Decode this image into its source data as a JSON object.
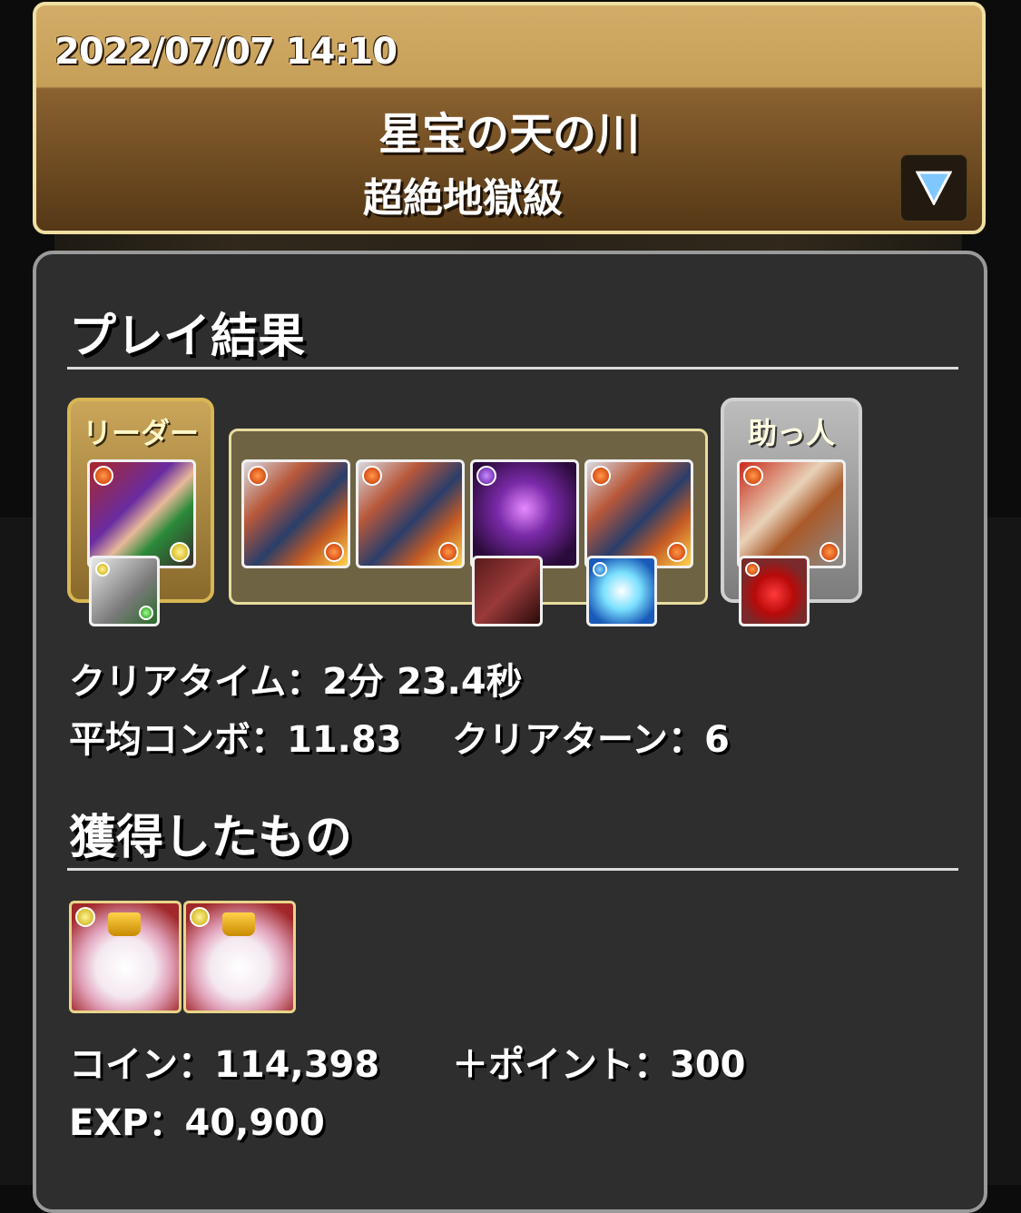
{
  "header": {
    "datetime": "2022/07/07 14:10",
    "dungeon_name": "星宝の天の川",
    "difficulty": "超絶地獄級"
  },
  "results": {
    "section_title": "プレイ結果",
    "leader_label": "リーダー",
    "helper_label": "助っ人",
    "clear_time_label": "クリアタイム：",
    "clear_time_value": "2分 23.4秒",
    "avg_combo_label": "平均コンボ：",
    "avg_combo_value": "11.83",
    "clear_turn_label": "クリアターン：",
    "clear_turn_value": "6"
  },
  "rewards": {
    "section_title": "獲得したもの",
    "coin_label": "コイン：",
    "coin_value": "114,398",
    "points_label": "＋ポイント：",
    "points_value": "300",
    "exp_label": "EXP：",
    "exp_value": "40,900",
    "drops": [
      {
        "icon": "tamazo-king-icon",
        "attribute": "light"
      },
      {
        "icon": "tamazo-king-icon",
        "attribute": "light"
      }
    ]
  },
  "team": {
    "leader": {
      "icon": "pirate-monster-icon",
      "main_attr": "fire",
      "sub_attr": "light",
      "assist": "card-assist-icon"
    },
    "subs": [
      {
        "icon": "fire-dragon-icon",
        "main_attr": "fire",
        "sub_attr": "fire"
      },
      {
        "icon": "fire-dragon-icon",
        "main_attr": "fire",
        "sub_attr": "fire"
      },
      {
        "icon": "void-monster-icon",
        "main_attr": "dark",
        "sub_attr": "",
        "assist": "book-assist-icon"
      },
      {
        "icon": "fire-dragon-icon",
        "main_attr": "fire",
        "sub_attr": "fire",
        "assist": "pet-assist-icon"
      }
    ],
    "helper": {
      "icon": "helper-monster-icon",
      "main_attr": "fire",
      "sub_attr": "fire",
      "assist": "apple-assist-icon"
    }
  },
  "colors": {
    "header_border": "#efe0a2",
    "panel_bg": "#2e2e2e",
    "panel_border": "#9a9a9a",
    "leader_gold": "#d8b653"
  }
}
